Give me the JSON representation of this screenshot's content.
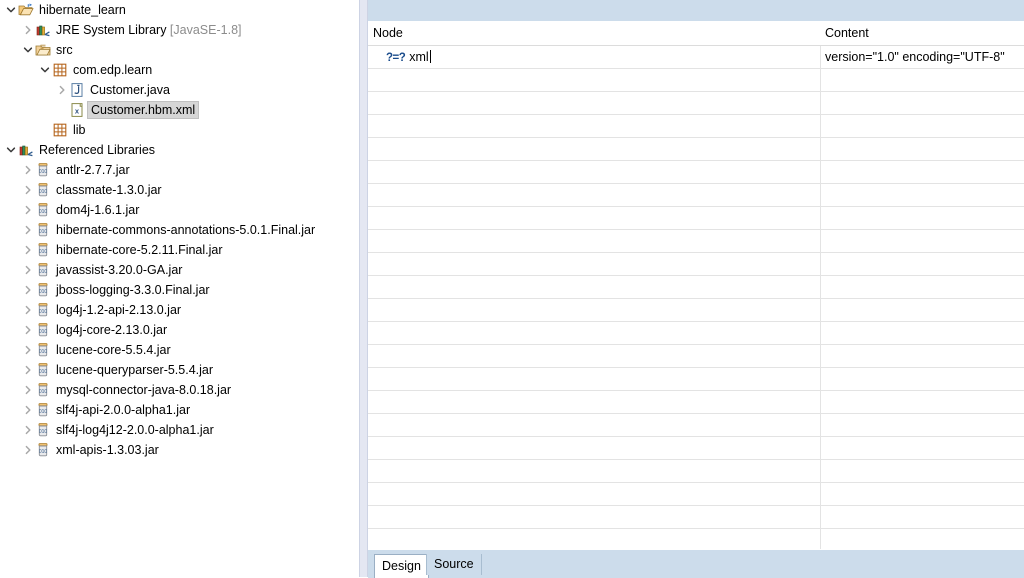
{
  "explorer": {
    "tree": [
      {
        "label": "hibernate_learn",
        "suffix": "",
        "indent": 0,
        "twisty": "down",
        "icon": "project-icon",
        "selected": false
      },
      {
        "label": "JRE System Library",
        "suffix": " [JavaSE-1.8]",
        "indent": 1,
        "twisty": "right",
        "icon": "library-icon",
        "selected": false
      },
      {
        "label": "src",
        "suffix": "",
        "indent": 1,
        "twisty": "down",
        "icon": "source-folder-icon",
        "selected": false
      },
      {
        "label": "com.edp.learn",
        "suffix": "",
        "indent": 2,
        "twisty": "down",
        "icon": "package-icon",
        "selected": false
      },
      {
        "label": "Customer.java",
        "suffix": "",
        "indent": 3,
        "twisty": "right",
        "icon": "java-file-icon",
        "selected": false
      },
      {
        "label": "Customer.hbm.xml",
        "suffix": "",
        "indent": 3,
        "twisty": "none",
        "icon": "xml-file-icon",
        "selected": true
      },
      {
        "label": "lib",
        "suffix": "",
        "indent": 2,
        "twisty": "none",
        "icon": "package-icon",
        "selected": false
      },
      {
        "label": "Referenced Libraries",
        "suffix": "",
        "indent": 0,
        "twisty": "down",
        "icon": "library-icon",
        "selected": false
      },
      {
        "label": "antlr-2.7.7.jar",
        "suffix": "",
        "indent": 1,
        "twisty": "right",
        "icon": "jar-icon",
        "selected": false
      },
      {
        "label": "classmate-1.3.0.jar",
        "suffix": "",
        "indent": 1,
        "twisty": "right",
        "icon": "jar-icon",
        "selected": false
      },
      {
        "label": "dom4j-1.6.1.jar",
        "suffix": "",
        "indent": 1,
        "twisty": "right",
        "icon": "jar-icon",
        "selected": false
      },
      {
        "label": "hibernate-commons-annotations-5.0.1.Final.jar",
        "suffix": "",
        "indent": 1,
        "twisty": "right",
        "icon": "jar-icon",
        "selected": false
      },
      {
        "label": "hibernate-core-5.2.11.Final.jar",
        "suffix": "",
        "indent": 1,
        "twisty": "right",
        "icon": "jar-icon",
        "selected": false
      },
      {
        "label": "javassist-3.20.0-GA.jar",
        "suffix": "",
        "indent": 1,
        "twisty": "right",
        "icon": "jar-icon",
        "selected": false
      },
      {
        "label": "jboss-logging-3.3.0.Final.jar",
        "suffix": "",
        "indent": 1,
        "twisty": "right",
        "icon": "jar-icon",
        "selected": false
      },
      {
        "label": "log4j-1.2-api-2.13.0.jar",
        "suffix": "",
        "indent": 1,
        "twisty": "right",
        "icon": "jar-icon",
        "selected": false
      },
      {
        "label": "log4j-core-2.13.0.jar",
        "suffix": "",
        "indent": 1,
        "twisty": "right",
        "icon": "jar-icon",
        "selected": false
      },
      {
        "label": "lucene-core-5.5.4.jar",
        "suffix": "",
        "indent": 1,
        "twisty": "right",
        "icon": "jar-icon",
        "selected": false
      },
      {
        "label": "lucene-queryparser-5.5.4.jar",
        "suffix": "",
        "indent": 1,
        "twisty": "right",
        "icon": "jar-icon",
        "selected": false
      },
      {
        "label": "mysql-connector-java-8.0.18.jar",
        "suffix": "",
        "indent": 1,
        "twisty": "right",
        "icon": "jar-icon",
        "selected": false
      },
      {
        "label": "slf4j-api-2.0.0-alpha1.jar",
        "suffix": "",
        "indent": 1,
        "twisty": "right",
        "icon": "jar-icon",
        "selected": false
      },
      {
        "label": "slf4j-log4j12-2.0.0-alpha1.jar",
        "suffix": "",
        "indent": 1,
        "twisty": "right",
        "icon": "jar-icon",
        "selected": false
      },
      {
        "label": "xml-apis-1.3.03.jar",
        "suffix": "",
        "indent": 1,
        "twisty": "right",
        "icon": "jar-icon",
        "selected": false
      }
    ]
  },
  "editor": {
    "columns": [
      {
        "key": "node",
        "label": "Node"
      },
      {
        "key": "content",
        "label": "Content"
      }
    ],
    "rows": [
      {
        "node_icon": "xml-processing-instruction-icon",
        "node": "xml",
        "content": "version=\"1.0\" encoding=\"UTF-8\""
      }
    ],
    "empty_row_count": 22,
    "tabs": [
      {
        "label": "Design",
        "active": true
      },
      {
        "label": "Source",
        "active": false
      }
    ]
  },
  "colors": {
    "toolbar_blue": "#ccdceb",
    "sash": "#e4e7f2",
    "selection": "#d6d6d6",
    "dim_text": "#8c8c8c",
    "grid_line": "#e3e3e3",
    "pi_icon": "#1a4c8c"
  }
}
